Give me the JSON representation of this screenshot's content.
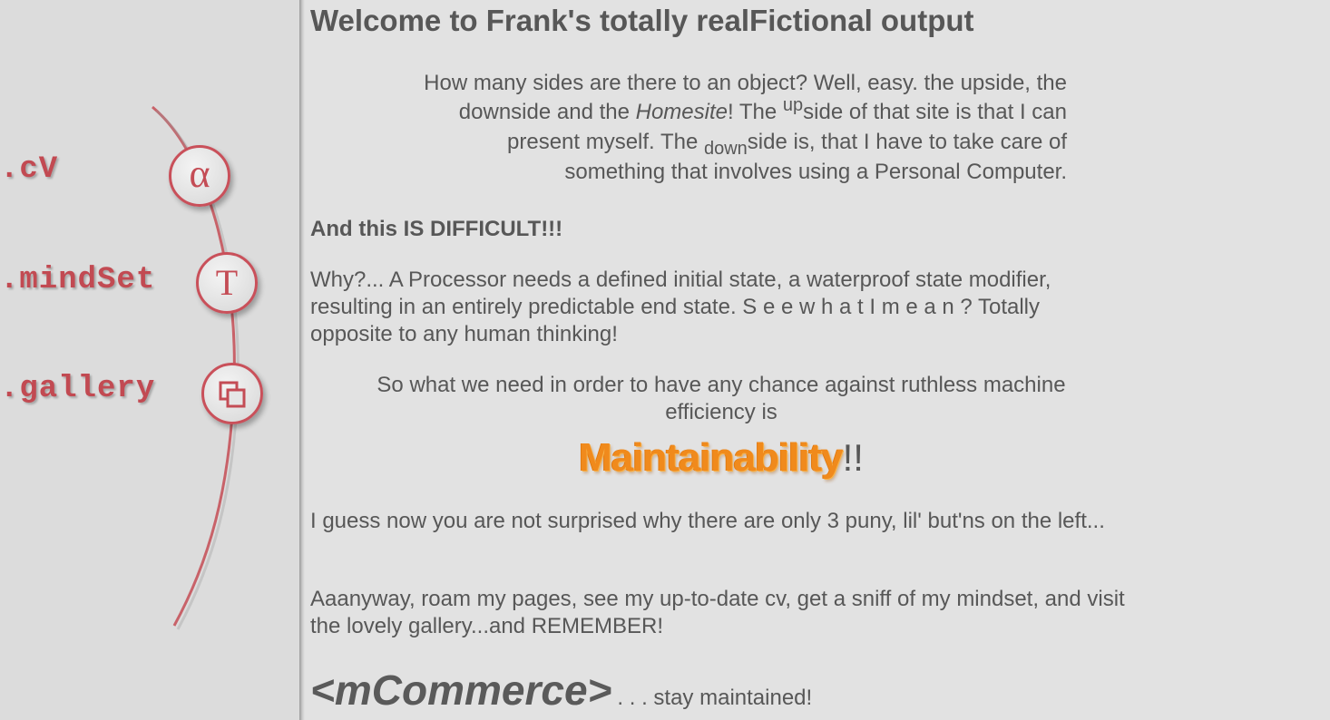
{
  "nav": {
    "items": [
      {
        "label": ".cV",
        "icon": "alpha-icon",
        "glyph": "α"
      },
      {
        "label": ".mindSet",
        "icon": "t-icon",
        "glyph": "T"
      },
      {
        "label": ".gallery",
        "icon": "gallery-icon",
        "glyph": ""
      }
    ],
    "accent_color": "#c24a52"
  },
  "main": {
    "title": "Welcome to Frank's totally realFictional output",
    "intro": {
      "part1": "How many sides are there to an object? Well, easy. the upside, the downside and the ",
      "homesite": "Homesite",
      "part2": "! The ",
      "up": "up",
      "part3": "side of that site is that I can present myself. The ",
      "down": "down",
      "part4": "side is, that I have to take care of something that involves using a Personal Computer."
    },
    "difficult": "And this IS DIFFICULT!!!",
    "why": "Why?... A Processor needs a defined initial state, a waterproof state modifier, resulting in an entirely predictable end state. S e e w h a t I m e a n ? Totally opposite to any human thinking!",
    "need": "So what we need in order to have any chance against ruthless machine efficiency is",
    "maintainability": "Maintainability",
    "exclaim": "!!",
    "buttons_note": "I guess now you are not surprised why there are only 3 puny, lil' but'ns on the left...",
    "roam": "Aaanyway, roam my pages, see my up-to-date cv, get a sniff of my mindset, and visit the lovely gallery...and REMEMBER!",
    "tag_word": "<mCommerce>",
    "tag_rest": ". . . stay maintained!",
    "maintain_color": "#f08a1c"
  }
}
